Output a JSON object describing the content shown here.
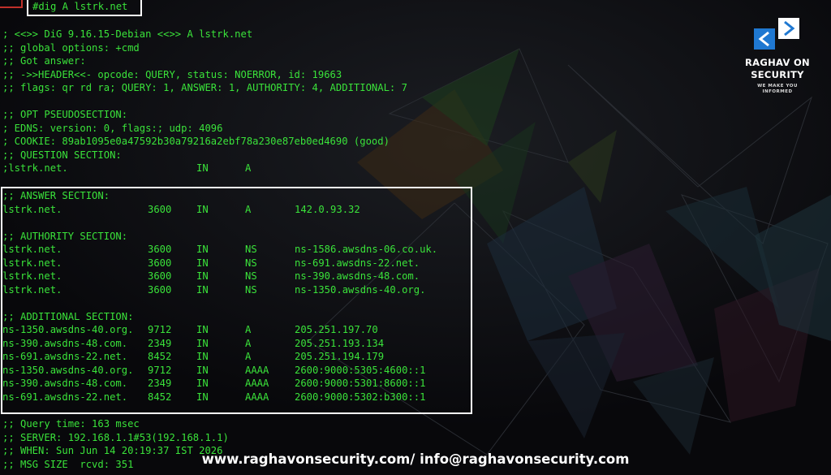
{
  "command": "#dig A lstrk.net",
  "header": [
    "; <<>> DiG 9.16.15-Debian <<>> A lstrk.net",
    ";; global options: +cmd",
    ";; Got answer:",
    ";; ->>HEADER<<- opcode: QUERY, status: NOERROR, id: 19663",
    ";; flags: qr rd ra; QUERY: 1, ANSWER: 1, AUTHORITY: 4, ADDITIONAL: 7"
  ],
  "opt": [
    ";; OPT PSEUDOSECTION:",
    "; EDNS: version: 0, flags:; udp: 4096",
    "; COOKIE: 89ab1095e0a47592b30a79216a2ebf78a230e87eb0ed4690 (good)",
    ";; QUESTION SECTION:"
  ],
  "question": {
    "name": ";lstrk.net.",
    "class": "IN",
    "type": "A"
  },
  "answer": {
    "title": ";; ANSWER SECTION:",
    "rows": [
      {
        "name": "lstrk.net.",
        "ttl": "3600",
        "class": "IN",
        "type": "A",
        "data": "142.0.93.32"
      }
    ]
  },
  "authority": {
    "title": ";; AUTHORITY SECTION:",
    "rows": [
      {
        "name": "lstrk.net.",
        "ttl": "3600",
        "class": "IN",
        "type": "NS",
        "data": "ns-1586.awsdns-06.co.uk."
      },
      {
        "name": "lstrk.net.",
        "ttl": "3600",
        "class": "IN",
        "type": "NS",
        "data": "ns-691.awsdns-22.net."
      },
      {
        "name": "lstrk.net.",
        "ttl": "3600",
        "class": "IN",
        "type": "NS",
        "data": "ns-390.awsdns-48.com."
      },
      {
        "name": "lstrk.net.",
        "ttl": "3600",
        "class": "IN",
        "type": "NS",
        "data": "ns-1350.awsdns-40.org."
      }
    ]
  },
  "additional": {
    "title": ";; ADDITIONAL SECTION:",
    "rows": [
      {
        "name": "ns-1350.awsdns-40.org.",
        "ttl": "9712",
        "class": "IN",
        "type": "A",
        "data": "205.251.197.70"
      },
      {
        "name": "ns-390.awsdns-48.com.",
        "ttl": "2349",
        "class": "IN",
        "type": "A",
        "data": "205.251.193.134"
      },
      {
        "name": "ns-691.awsdns-22.net.",
        "ttl": "8452",
        "class": "IN",
        "type": "A",
        "data": "205.251.194.179"
      },
      {
        "name": "ns-1350.awsdns-40.org.",
        "ttl": "9712",
        "class": "IN",
        "type": "AAAA",
        "data": "2600:9000:5305:4600::1"
      },
      {
        "name": "ns-390.awsdns-48.com.",
        "ttl": "2349",
        "class": "IN",
        "type": "AAAA",
        "data": "2600:9000:5301:8600::1"
      },
      {
        "name": "ns-691.awsdns-22.net.",
        "ttl": "8452",
        "class": "IN",
        "type": "AAAA",
        "data": "2600:9000:5302:b300::1"
      }
    ]
  },
  "stats": [
    ";; Query time: 163 msec",
    ";; SERVER: 192.168.1.1#53(192.168.1.1)",
    ";; WHEN: Sun Jun 14 20:19:37 IST 2026",
    ";; MSG SIZE  rcvd: 351"
  ],
  "logo": {
    "name_line1": "RAGHAV ON",
    "name_line2": "SECURITY",
    "tagline": "WE MAKE YOU INFORMED",
    "icon": "code-brackets-icon"
  },
  "footer": "www.raghavonsecurity.com/ info@raghavonsecurity.com",
  "colors": {
    "terminal_text": "#3ae23a",
    "background": "#0a0a0d",
    "highlight_border": "#ffffff",
    "logo_blue": "#1f78d1"
  }
}
